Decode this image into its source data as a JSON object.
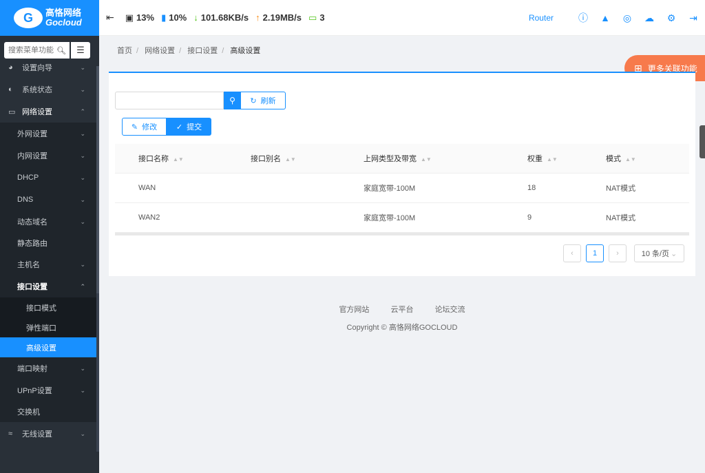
{
  "brand": {
    "cn": "高恪网络",
    "en": "Gocloud",
    "mark": "G"
  },
  "sidebar": {
    "search_placeholder": "搜索菜单功能",
    "items": [
      {
        "label": "设置向导",
        "icon": "compass-icon"
      },
      {
        "label": "系统状态",
        "icon": "dashboard-icon"
      },
      {
        "label": "网络设置",
        "icon": "monitor-icon"
      }
    ],
    "network_sub": [
      "外网设置",
      "内网设置",
      "DHCP",
      "DNS",
      "动态域名",
      "静态路由",
      "主机名",
      "接口设置"
    ],
    "interface_sub": [
      "接口模式",
      "弹性端口",
      "高级设置"
    ],
    "after_sub": [
      "端口映射",
      "UPnP设置",
      "交换机"
    ],
    "wireless": "无线设置"
  },
  "topbar": {
    "cpu": "13%",
    "mem": "10%",
    "down": "101.68KB/s",
    "up": "2.19MB/s",
    "devices": "3",
    "router": "Router"
  },
  "breadcrumb": [
    "首页",
    "网络设置",
    "接口设置",
    "高级设置"
  ],
  "more_functions": "更多关联功能",
  "toolbar": {
    "refresh": "刷新",
    "edit": "修改",
    "submit": "提交",
    "search_placeholder": ""
  },
  "table": {
    "headers": [
      "接口名称",
      "接口别名",
      "上网类型及带宽",
      "权重",
      "模式"
    ],
    "rows": [
      [
        "WAN",
        "",
        "家庭宽带-100M",
        "18",
        "NAT模式"
      ],
      [
        "WAN2",
        "",
        "家庭宽带-100M",
        "9",
        "NAT模式"
      ]
    ]
  },
  "pagination": {
    "current": "1",
    "page_size": "10 条/页"
  },
  "footer": {
    "links": [
      "官方网站",
      "云平台",
      "论坛交流"
    ],
    "copyright": "Copyright © 高恪网络GOCLOUD"
  },
  "colors": {
    "primary": "#1890ff",
    "sidebar": "#293038",
    "orange": "#f77a4c"
  }
}
